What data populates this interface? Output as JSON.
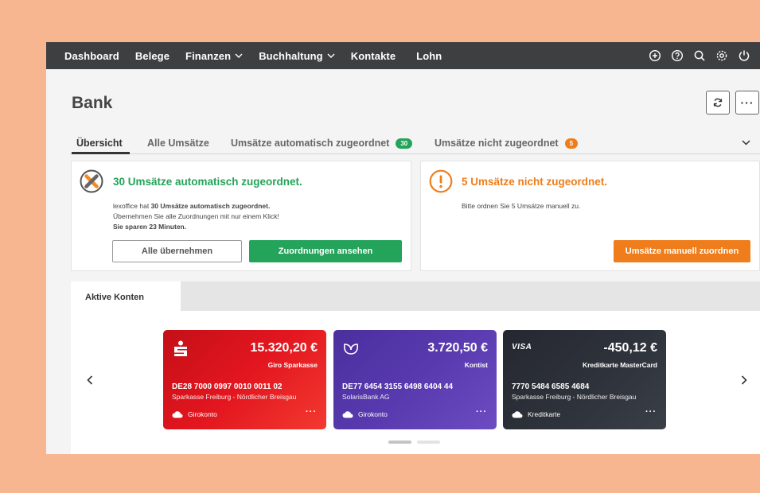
{
  "nav": {
    "items": [
      {
        "label": "Dashboard"
      },
      {
        "label": "Belege"
      },
      {
        "label": "Finanzen"
      },
      {
        "label": "Buchhaltung"
      },
      {
        "label": "Kontakte"
      },
      {
        "label": "Lohn"
      }
    ],
    "icons": [
      "add-circle-icon",
      "help-icon",
      "search-icon",
      "settings-icon",
      "power-icon"
    ]
  },
  "page": {
    "title": "Bank",
    "refresh_icon": "refresh-icon",
    "more_label": "···"
  },
  "tabs": [
    {
      "label": "Übersicht"
    },
    {
      "label": "Alle Umsätze"
    },
    {
      "label": "Umsätze automatisch zugeordnet",
      "badge": "30"
    },
    {
      "label": "Umsätze nicht zugeordnet",
      "badge": "5"
    }
  ],
  "auto_card": {
    "title": "30 Umsätze automatisch zugeordnet.",
    "line1_prefix": "lexoffice hat ",
    "line1_bold": "30 Umsätze automatisch zugeordnet.",
    "line2": "Übernehmen Sie alle Zuordnungen mit nur einem Klick!",
    "line3": "Sie sparen 23 Minuten.",
    "btn_secondary": "Alle übernehmen",
    "btn_primary": "Zuordnungen ansehen"
  },
  "manual_card": {
    "title": "5 Umsätze nicht zugeordnet.",
    "text": "Bitte ordnen Sie 5 Umsätze manuell zu.",
    "btn": "Umsätze manuell zuordnen"
  },
  "konten": {
    "tab_label": "Aktive Konten",
    "cards": [
      {
        "amount": "15.320,20 €",
        "name": "Giro Sparkasse",
        "iban": "DE28 7000 0997 0010 0011 02",
        "bank": "Sparkasse Freiburg - Nördlicher Breisgau",
        "type": "Girokonto",
        "logo": "sparkasse-logo"
      },
      {
        "amount": "3.720,50 €",
        "name": "Kontist",
        "iban": "DE77 6454 3155 6498 6404 44",
        "bank": "SolarisBank AG",
        "type": "Girokonto",
        "logo": "kontist-logo"
      },
      {
        "amount": "-450,12 €",
        "name": "Kreditkarte MasterCard",
        "iban": "7770 5484 6585 4684",
        "bank": "Sparkasse Freiburg - Nördlicher Breisgau",
        "type": "Kreditkarte",
        "logo": "visa-logo"
      }
    ]
  },
  "colors": {
    "nav_bg": "#3d3f41",
    "green": "#24a35a",
    "orange": "#ef7d1b",
    "sparkasse_red": "#e3161f",
    "kontist_purple": "#5a3bb0",
    "credit_dark": "#2e323a"
  }
}
